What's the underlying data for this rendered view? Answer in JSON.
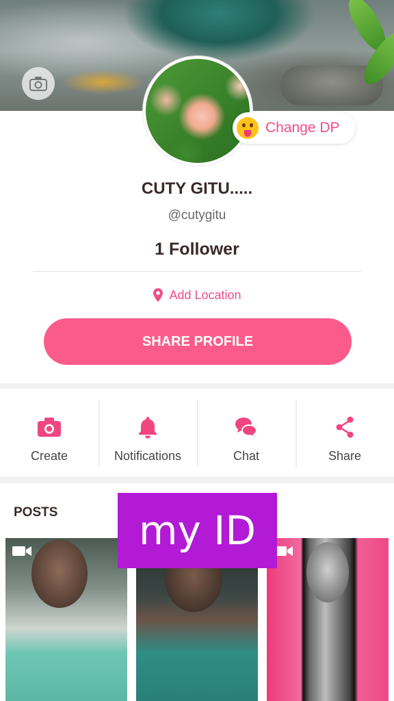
{
  "profile": {
    "change_dp_label": "Change DP",
    "name": "CUTY GITU.....",
    "handle": "@cutygitu",
    "followers": "1 Follower",
    "location_label": "Add Location",
    "share_profile_label": "SHARE PROFILE"
  },
  "actions": [
    {
      "label": "Create",
      "icon": "camera-icon"
    },
    {
      "label": "Notifications",
      "icon": "bell-icon"
    },
    {
      "label": "Chat",
      "icon": "chat-icon"
    },
    {
      "label": "Share",
      "icon": "share-icon"
    }
  ],
  "posts": {
    "title": "POSTS"
  },
  "overlay": {
    "banner_text": "my ID"
  },
  "colors": {
    "accent": "#fb5b8b",
    "accent_text": "#ef4f83",
    "banner": "#b21ad6"
  }
}
